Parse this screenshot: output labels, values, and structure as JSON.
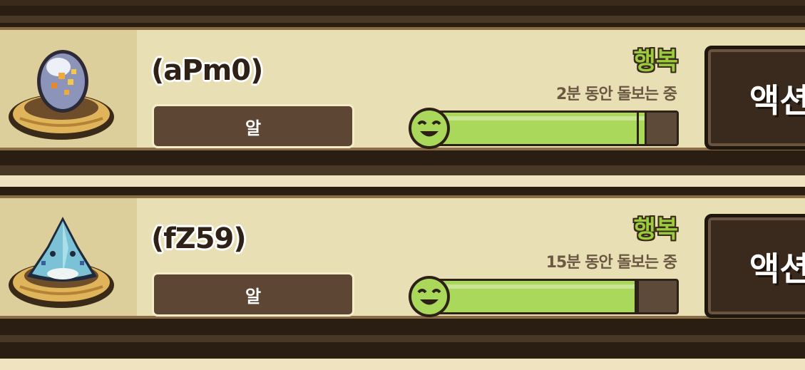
{
  "pets": [
    {
      "name": "(aPm0)",
      "type_label": "알",
      "mood": "행복",
      "care_status": "2분 동안 돌보는 중",
      "happiness": 0.88,
      "action_label": "액션",
      "icon": "egg-in-nest-icon"
    },
    {
      "name": "(fZ59)",
      "type_label": "알",
      "mood": "행복",
      "care_status": "15분 동안 돌보는 중",
      "happiness": 0.84,
      "action_label": "액션",
      "icon": "shark-egg-in-nest-icon"
    }
  ],
  "colors": {
    "card_bg": "#e9dfb5",
    "mood_green": "#9acc3e",
    "bar_fill": "#a9d85a",
    "badge_bg": "#5d4734"
  }
}
